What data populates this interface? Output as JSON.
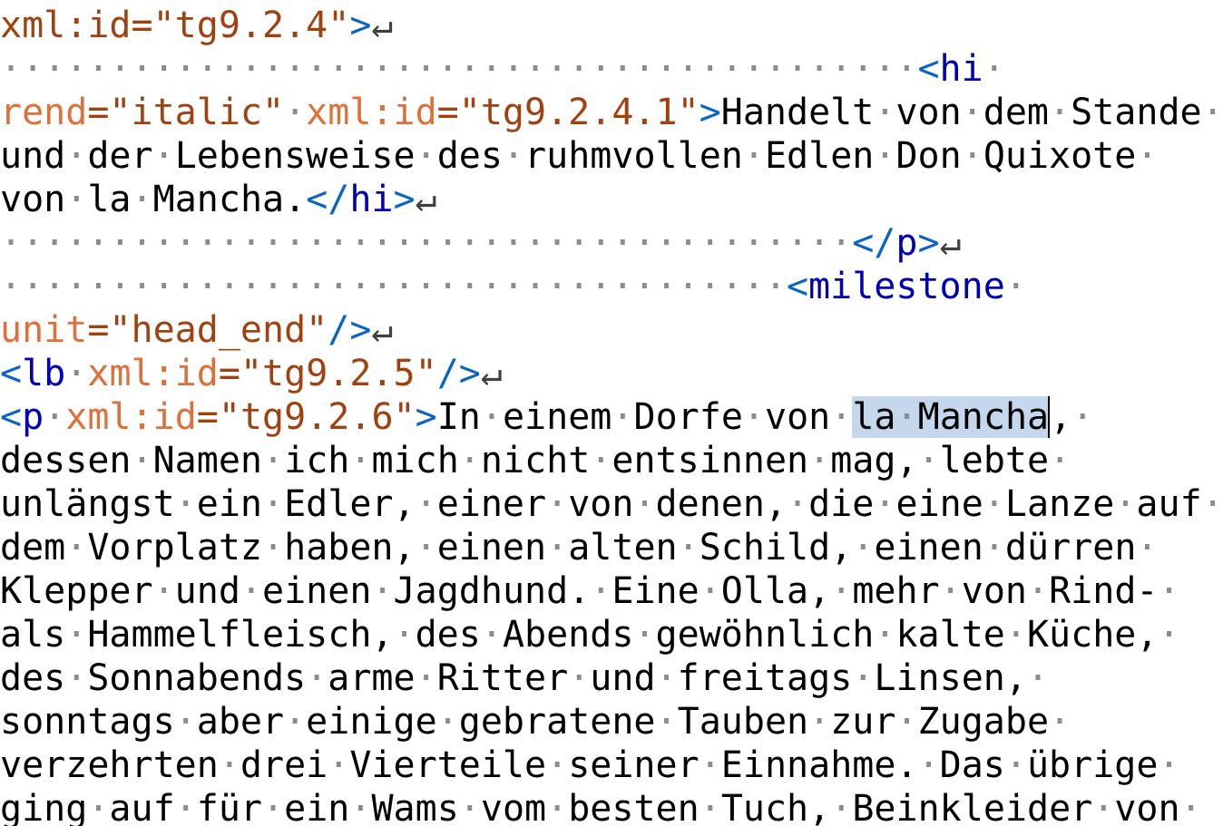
{
  "editor": {
    "lines": [
      {
        "segments": [
          {
            "t": "val",
            "v": "xml:id=\"tg9.2.4\""
          },
          {
            "t": "tag",
            "v": ">"
          },
          {
            "t": "ret",
            "v": "↵"
          }
        ]
      },
      {
        "segments": [
          {
            "t": "ws",
            "v": "··········································"
          },
          {
            "t": "tag",
            "v": "<"
          },
          {
            "t": "tagname",
            "v": "hi"
          },
          {
            "t": "ws",
            "v": "·"
          }
        ]
      },
      {
        "segments": [
          {
            "t": "attr",
            "v": "rend"
          },
          {
            "t": "val",
            "v": "=\"italic\""
          },
          {
            "t": "ws",
            "v": "·"
          },
          {
            "t": "attr",
            "v": "xml:id"
          },
          {
            "t": "val",
            "v": "=\"tg9.2.4.1\""
          },
          {
            "t": "tag",
            "v": ">"
          },
          {
            "t": "text",
            "v": "Handelt"
          },
          {
            "t": "ws",
            "v": "·"
          },
          {
            "t": "text",
            "v": "von"
          },
          {
            "t": "ws",
            "v": "·"
          },
          {
            "t": "text",
            "v": "dem"
          },
          {
            "t": "ws",
            "v": "·"
          },
          {
            "t": "text",
            "v": "Stande"
          },
          {
            "t": "ws",
            "v": "·"
          }
        ]
      },
      {
        "segments": [
          {
            "t": "text",
            "v": "und"
          },
          {
            "t": "ws",
            "v": "·"
          },
          {
            "t": "text",
            "v": "der"
          },
          {
            "t": "ws",
            "v": "·"
          },
          {
            "t": "text",
            "v": "Lebensweise"
          },
          {
            "t": "ws",
            "v": "·"
          },
          {
            "t": "text",
            "v": "des"
          },
          {
            "t": "ws",
            "v": "·"
          },
          {
            "t": "text",
            "v": "ruhmvollen"
          },
          {
            "t": "ws",
            "v": "·"
          },
          {
            "t": "text",
            "v": "Edlen"
          },
          {
            "t": "ws",
            "v": "·"
          },
          {
            "t": "text",
            "v": "Don"
          },
          {
            "t": "ws",
            "v": "·"
          },
          {
            "t": "text",
            "v": "Quixote"
          },
          {
            "t": "ws",
            "v": "·"
          }
        ]
      },
      {
        "segments": [
          {
            "t": "text",
            "v": "von"
          },
          {
            "t": "ws",
            "v": "·"
          },
          {
            "t": "text",
            "v": "la"
          },
          {
            "t": "ws",
            "v": "·"
          },
          {
            "t": "text",
            "v": "Mancha."
          },
          {
            "t": "tag",
            "v": "</"
          },
          {
            "t": "tagname",
            "v": "hi"
          },
          {
            "t": "tag",
            "v": ">"
          },
          {
            "t": "ret",
            "v": "↵"
          }
        ]
      },
      {
        "segments": [
          {
            "t": "ws",
            "v": "·······································"
          },
          {
            "t": "tag",
            "v": "</"
          },
          {
            "t": "tagname",
            "v": "p"
          },
          {
            "t": "tag",
            "v": ">"
          },
          {
            "t": "ret",
            "v": "↵"
          }
        ]
      },
      {
        "segments": [
          {
            "t": "ws",
            "v": "····································"
          },
          {
            "t": "tag",
            "v": "<"
          },
          {
            "t": "tagname",
            "v": "milestone"
          },
          {
            "t": "ws",
            "v": "·"
          }
        ]
      },
      {
        "segments": [
          {
            "t": "attr",
            "v": "unit"
          },
          {
            "t": "val",
            "v": "=\"head_end\""
          },
          {
            "t": "tag",
            "v": "/>"
          },
          {
            "t": "ret",
            "v": "↵"
          }
        ]
      },
      {
        "segments": [
          {
            "t": "tag",
            "v": "<"
          },
          {
            "t": "tagname",
            "v": "lb"
          },
          {
            "t": "ws",
            "v": "·"
          },
          {
            "t": "attr",
            "v": "xml:id"
          },
          {
            "t": "val",
            "v": "=\"tg9.2.5\""
          },
          {
            "t": "tag",
            "v": "/>"
          },
          {
            "t": "ret",
            "v": "↵"
          }
        ]
      },
      {
        "segments": [
          {
            "t": "tag",
            "v": "<"
          },
          {
            "t": "tagname",
            "v": "p"
          },
          {
            "t": "ws",
            "v": "·"
          },
          {
            "t": "attr",
            "v": "xml:id"
          },
          {
            "t": "val",
            "v": "=\"tg9.2.6\""
          },
          {
            "t": "tag",
            "v": ">"
          },
          {
            "t": "text",
            "v": "In"
          },
          {
            "t": "ws",
            "v": "·"
          },
          {
            "t": "text",
            "v": "einem"
          },
          {
            "t": "ws",
            "v": "·"
          },
          {
            "t": "text",
            "v": "Dorfe"
          },
          {
            "t": "ws",
            "v": "·"
          },
          {
            "t": "text",
            "v": "von"
          },
          {
            "t": "ws",
            "v": "·"
          },
          {
            "t": "seltext",
            "v": "la"
          },
          {
            "t": "selws",
            "v": "·"
          },
          {
            "t": "seltext",
            "v": "Mancha"
          },
          {
            "t": "caret",
            "v": ""
          },
          {
            "t": "text",
            "v": ","
          },
          {
            "t": "ws",
            "v": "·"
          }
        ]
      },
      {
        "segments": [
          {
            "t": "text",
            "v": "dessen"
          },
          {
            "t": "ws",
            "v": "·"
          },
          {
            "t": "text",
            "v": "Namen"
          },
          {
            "t": "ws",
            "v": "·"
          },
          {
            "t": "text",
            "v": "ich"
          },
          {
            "t": "ws",
            "v": "·"
          },
          {
            "t": "text",
            "v": "mich"
          },
          {
            "t": "ws",
            "v": "·"
          },
          {
            "t": "text",
            "v": "nicht"
          },
          {
            "t": "ws",
            "v": "·"
          },
          {
            "t": "text",
            "v": "entsinnen"
          },
          {
            "t": "ws",
            "v": "·"
          },
          {
            "t": "text",
            "v": "mag,"
          },
          {
            "t": "ws",
            "v": "·"
          },
          {
            "t": "text",
            "v": "lebte"
          },
          {
            "t": "ws",
            "v": "·"
          }
        ]
      },
      {
        "segments": [
          {
            "t": "text",
            "v": "unlängst"
          },
          {
            "t": "ws",
            "v": "·"
          },
          {
            "t": "text",
            "v": "ein"
          },
          {
            "t": "ws",
            "v": "·"
          },
          {
            "t": "text",
            "v": "Edler,"
          },
          {
            "t": "ws",
            "v": "·"
          },
          {
            "t": "text",
            "v": "einer"
          },
          {
            "t": "ws",
            "v": "·"
          },
          {
            "t": "text",
            "v": "von"
          },
          {
            "t": "ws",
            "v": "·"
          },
          {
            "t": "text",
            "v": "denen,"
          },
          {
            "t": "ws",
            "v": "·"
          },
          {
            "t": "text",
            "v": "die"
          },
          {
            "t": "ws",
            "v": "·"
          },
          {
            "t": "text",
            "v": "eine"
          },
          {
            "t": "ws",
            "v": "·"
          },
          {
            "t": "text",
            "v": "Lanze"
          },
          {
            "t": "ws",
            "v": "·"
          },
          {
            "t": "text",
            "v": "auf"
          },
          {
            "t": "ws",
            "v": "·"
          }
        ]
      },
      {
        "segments": [
          {
            "t": "text",
            "v": "dem"
          },
          {
            "t": "ws",
            "v": "·"
          },
          {
            "t": "text",
            "v": "Vorplatz"
          },
          {
            "t": "ws",
            "v": "·"
          },
          {
            "t": "text",
            "v": "haben,"
          },
          {
            "t": "ws",
            "v": "·"
          },
          {
            "t": "text",
            "v": "einen"
          },
          {
            "t": "ws",
            "v": "·"
          },
          {
            "t": "text",
            "v": "alten"
          },
          {
            "t": "ws",
            "v": "·"
          },
          {
            "t": "text",
            "v": "Schild,"
          },
          {
            "t": "ws",
            "v": "·"
          },
          {
            "t": "text",
            "v": "einen"
          },
          {
            "t": "ws",
            "v": "·"
          },
          {
            "t": "text",
            "v": "dürren"
          },
          {
            "t": "ws",
            "v": "·"
          }
        ]
      },
      {
        "segments": [
          {
            "t": "text",
            "v": "Klepper"
          },
          {
            "t": "ws",
            "v": "·"
          },
          {
            "t": "text",
            "v": "und"
          },
          {
            "t": "ws",
            "v": "·"
          },
          {
            "t": "text",
            "v": "einen"
          },
          {
            "t": "ws",
            "v": "·"
          },
          {
            "t": "text",
            "v": "Jagdhund."
          },
          {
            "t": "ws",
            "v": "·"
          },
          {
            "t": "text",
            "v": "Eine"
          },
          {
            "t": "ws",
            "v": "·"
          },
          {
            "t": "text",
            "v": "Olla,"
          },
          {
            "t": "ws",
            "v": "·"
          },
          {
            "t": "text",
            "v": "mehr"
          },
          {
            "t": "ws",
            "v": "·"
          },
          {
            "t": "text",
            "v": "von"
          },
          {
            "t": "ws",
            "v": "·"
          },
          {
            "t": "text",
            "v": "Rind-"
          },
          {
            "t": "ws",
            "v": "·"
          }
        ]
      },
      {
        "segments": [
          {
            "t": "text",
            "v": "als"
          },
          {
            "t": "ws",
            "v": "·"
          },
          {
            "t": "text",
            "v": "Hammelfleisch,"
          },
          {
            "t": "ws",
            "v": "·"
          },
          {
            "t": "text",
            "v": "des"
          },
          {
            "t": "ws",
            "v": "·"
          },
          {
            "t": "text",
            "v": "Abends"
          },
          {
            "t": "ws",
            "v": "·"
          },
          {
            "t": "text",
            "v": "gewöhnlich"
          },
          {
            "t": "ws",
            "v": "·"
          },
          {
            "t": "text",
            "v": "kalte"
          },
          {
            "t": "ws",
            "v": "·"
          },
          {
            "t": "text",
            "v": "Küche,"
          },
          {
            "t": "ws",
            "v": "·"
          }
        ]
      },
      {
        "segments": [
          {
            "t": "text",
            "v": "des"
          },
          {
            "t": "ws",
            "v": "·"
          },
          {
            "t": "text",
            "v": "Sonnabends"
          },
          {
            "t": "ws",
            "v": "·"
          },
          {
            "t": "text",
            "v": "arme"
          },
          {
            "t": "ws",
            "v": "·"
          },
          {
            "t": "text",
            "v": "Ritter"
          },
          {
            "t": "ws",
            "v": "·"
          },
          {
            "t": "text",
            "v": "und"
          },
          {
            "t": "ws",
            "v": "·"
          },
          {
            "t": "text",
            "v": "freitags"
          },
          {
            "t": "ws",
            "v": "·"
          },
          {
            "t": "text",
            "v": "Linsen,"
          },
          {
            "t": "ws",
            "v": "·"
          }
        ]
      },
      {
        "segments": [
          {
            "t": "text",
            "v": "sonntags"
          },
          {
            "t": "ws",
            "v": "·"
          },
          {
            "t": "text",
            "v": "aber"
          },
          {
            "t": "ws",
            "v": "·"
          },
          {
            "t": "text",
            "v": "einige"
          },
          {
            "t": "ws",
            "v": "·"
          },
          {
            "t": "text",
            "v": "gebratene"
          },
          {
            "t": "ws",
            "v": "·"
          },
          {
            "t": "text",
            "v": "Tauben"
          },
          {
            "t": "ws",
            "v": "·"
          },
          {
            "t": "text",
            "v": "zur"
          },
          {
            "t": "ws",
            "v": "·"
          },
          {
            "t": "text",
            "v": "Zugabe"
          },
          {
            "t": "ws",
            "v": "·"
          }
        ]
      },
      {
        "segments": [
          {
            "t": "text",
            "v": "verzehrten"
          },
          {
            "t": "ws",
            "v": "·"
          },
          {
            "t": "text",
            "v": "drei"
          },
          {
            "t": "ws",
            "v": "·"
          },
          {
            "t": "text",
            "v": "Vierteile"
          },
          {
            "t": "ws",
            "v": "·"
          },
          {
            "t": "text",
            "v": "seiner"
          },
          {
            "t": "ws",
            "v": "·"
          },
          {
            "t": "text",
            "v": "Einnahme."
          },
          {
            "t": "ws",
            "v": "·"
          },
          {
            "t": "text",
            "v": "Das"
          },
          {
            "t": "ws",
            "v": "·"
          },
          {
            "t": "text",
            "v": "übrige"
          },
          {
            "t": "ws",
            "v": "·"
          }
        ]
      },
      {
        "segments": [
          {
            "t": "text",
            "v": "ging"
          },
          {
            "t": "ws",
            "v": "·"
          },
          {
            "t": "text",
            "v": "auf"
          },
          {
            "t": "ws",
            "v": "·"
          },
          {
            "t": "text",
            "v": "für"
          },
          {
            "t": "ws",
            "v": "·"
          },
          {
            "t": "text",
            "v": "ein"
          },
          {
            "t": "ws",
            "v": "·"
          },
          {
            "t": "text",
            "v": "Wams"
          },
          {
            "t": "ws",
            "v": "·"
          },
          {
            "t": "text",
            "v": "vom"
          },
          {
            "t": "ws",
            "v": "·"
          },
          {
            "t": "text",
            "v": "besten"
          },
          {
            "t": "ws",
            "v": "·"
          },
          {
            "t": "text",
            "v": "Tuch,"
          },
          {
            "t": "ws",
            "v": "·"
          },
          {
            "t": "text",
            "v": "Beinkleider"
          },
          {
            "t": "ws",
            "v": "·"
          },
          {
            "t": "text",
            "v": "von"
          },
          {
            "t": "ws",
            "v": "·"
          }
        ]
      }
    ]
  }
}
